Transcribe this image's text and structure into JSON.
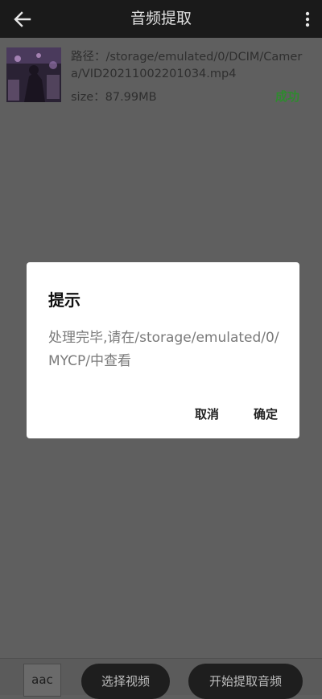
{
  "topbar": {
    "title": "音频提取",
    "back_icon": "arrow-left-icon",
    "more_icon": "more-vertical-icon"
  },
  "item": {
    "path_text": "路径：/storage/emulated/0/DCIM/Camera/VID20211002201034.mp4",
    "size_text": "size：87.99MB",
    "status": "成功"
  },
  "dialog": {
    "title": "提示",
    "message": "处理完毕,请在/storage/emulated/0/MYCP/中查看",
    "cancel_label": "取消",
    "ok_label": "确定"
  },
  "bottombar": {
    "format_value": "aac",
    "select_video_label": "选择视频",
    "start_extract_label": "开始提取音频"
  },
  "colors": {
    "status_green": "#2f8a2f",
    "topbar_bg": "#1a1a1a",
    "overlay_bg": "#5f5f5f"
  }
}
